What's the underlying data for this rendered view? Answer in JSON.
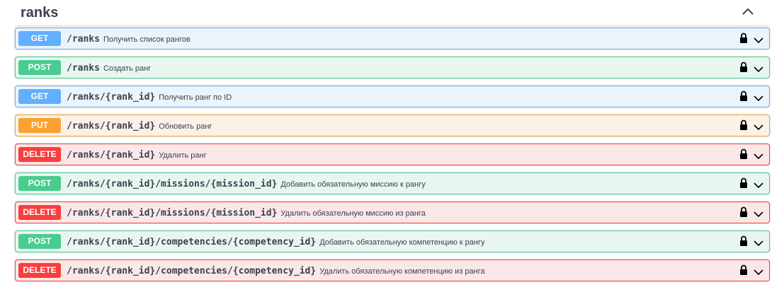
{
  "section": {
    "title": "ranks",
    "collapse_icon": "chevron-up-icon"
  },
  "operations": [
    {
      "method": "GET",
      "path": "/ranks",
      "summary": "Получить список рангов"
    },
    {
      "method": "POST",
      "path": "/ranks",
      "summary": "Создать ранг"
    },
    {
      "method": "GET",
      "path": "/ranks/{rank_id}",
      "summary": "Получить ранг по ID"
    },
    {
      "method": "PUT",
      "path": "/ranks/{rank_id}",
      "summary": "Обновить ранг"
    },
    {
      "method": "DELETE",
      "path": "/ranks/{rank_id}",
      "summary": "Удалить ранг"
    },
    {
      "method": "POST",
      "path": "/ranks/{rank_id}/missions/{mission_id}",
      "summary": "Добавить обязательную миссию к рангу"
    },
    {
      "method": "DELETE",
      "path": "/ranks/{rank_id}/missions/{mission_id}",
      "summary": "Удалить обязательную миссию из ранга"
    },
    {
      "method": "POST",
      "path": "/ranks/{rank_id}/competencies/{competency_id}",
      "summary": "Добавить обязательную компетенцию к рангу"
    },
    {
      "method": "DELETE",
      "path": "/ranks/{rank_id}/competencies/{competency_id}",
      "summary": "Удалить обязательную компетенцию из ранга"
    }
  ],
  "icons": {
    "lock": "lock-icon",
    "expand": "chevron-down-icon"
  },
  "colors": {
    "get": "#61affe",
    "post": "#49cc90",
    "put": "#fca130",
    "delete": "#f93e3e",
    "text": "#3b4151"
  }
}
